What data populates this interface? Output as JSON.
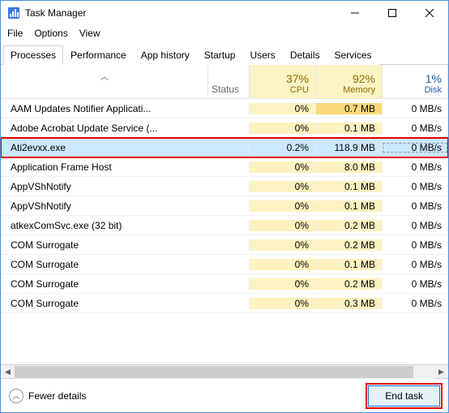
{
  "window": {
    "title": "Task Manager"
  },
  "menu": {
    "file": "File",
    "options": "Options",
    "view": "View"
  },
  "tabs": [
    "Processes",
    "Performance",
    "App history",
    "Startup",
    "Users",
    "Details",
    "Services"
  ],
  "activeTab": 0,
  "headers": {
    "status": "Status",
    "cols": [
      {
        "pct": "37%",
        "label": "CPU",
        "yellow": true
      },
      {
        "pct": "92%",
        "label": "Memory",
        "yellow": true
      },
      {
        "pct": "1%",
        "label": "Disk",
        "yellow": false
      }
    ]
  },
  "rows": [
    {
      "name": "AAM Updates Notifier Applicati...",
      "cpu": "0%",
      "mem": "0.7 MB",
      "memElev": true,
      "disk": "0 MB/s",
      "sel": false,
      "hl": false
    },
    {
      "name": "Adobe Acrobat Update Service (...",
      "cpu": "0%",
      "mem": "0.1 MB",
      "memElev": false,
      "disk": "0 MB/s",
      "sel": false,
      "hl": false
    },
    {
      "name": "Ati2evxx.exe",
      "cpu": "0.2%",
      "mem": "118.9 MB",
      "memElev": false,
      "disk": "0 MB/s",
      "sel": true,
      "hl": true
    },
    {
      "name": "Application Frame Host",
      "cpu": "0%",
      "mem": "8.0 MB",
      "memElev": false,
      "disk": "0 MB/s",
      "sel": false,
      "hl": false
    },
    {
      "name": "AppVShNotify",
      "cpu": "0%",
      "mem": "0.1 MB",
      "memElev": false,
      "disk": "0 MB/s",
      "sel": false,
      "hl": false
    },
    {
      "name": "AppVShNotify",
      "cpu": "0%",
      "mem": "0.1 MB",
      "memElev": false,
      "disk": "0 MB/s",
      "sel": false,
      "hl": false
    },
    {
      "name": "atkexComSvc.exe (32 bit)",
      "cpu": "0%",
      "mem": "0.2 MB",
      "memElev": false,
      "disk": "0 MB/s",
      "sel": false,
      "hl": false
    },
    {
      "name": "COM Surrogate",
      "cpu": "0%",
      "mem": "0.2 MB",
      "memElev": false,
      "disk": "0 MB/s",
      "sel": false,
      "hl": false
    },
    {
      "name": "COM Surrogate",
      "cpu": "0%",
      "mem": "0.1 MB",
      "memElev": false,
      "disk": "0 MB/s",
      "sel": false,
      "hl": false
    },
    {
      "name": "COM Surrogate",
      "cpu": "0%",
      "mem": "0.2 MB",
      "memElev": false,
      "disk": "0 MB/s",
      "sel": false,
      "hl": false
    },
    {
      "name": "COM Surrogate",
      "cpu": "0%",
      "mem": "0.3 MB",
      "memElev": false,
      "disk": "0 MB/s",
      "sel": false,
      "hl": false
    }
  ],
  "footer": {
    "fewer": "Fewer details",
    "endtask": "End task"
  }
}
